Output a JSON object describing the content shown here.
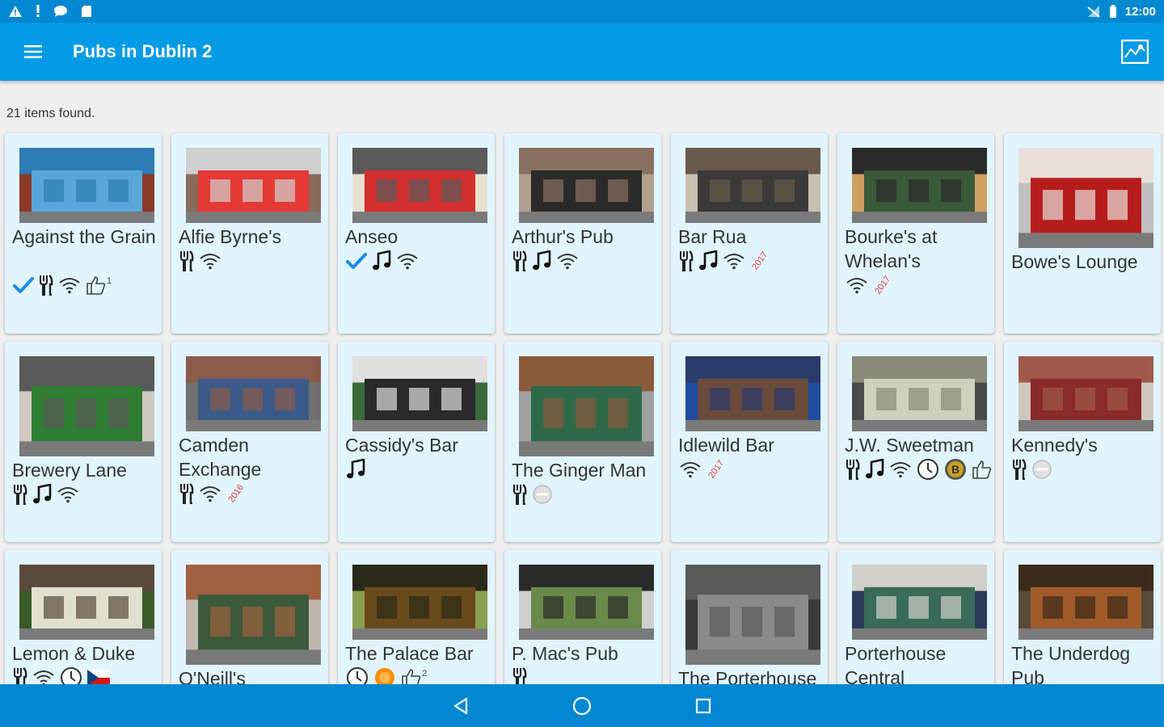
{
  "status_bar": {
    "time": "12:00"
  },
  "app_bar": {
    "title": "Pubs in  Dublin 2"
  },
  "results": {
    "count_text": "21 items found."
  },
  "colors": {
    "primary": "#039BE5",
    "primary_dark": "#0288D1",
    "card_bg": "#E1F5FE",
    "check": "#1E88E5",
    "year": "#E53935"
  },
  "pubs": [
    {
      "name": "Against the Grain",
      "icons": [
        "check-icon",
        "cutlery-icon",
        "wifi-icon",
        "thumbs-up-icon"
      ],
      "thumb_count": "1",
      "photo_colors": [
        "#2E7BB5",
        "#5BA6D8",
        "#8B3A2A"
      ]
    },
    {
      "name": "Alfie Byrne's",
      "icons": [
        "cutlery-icon",
        "wifi-icon"
      ],
      "photo_colors": [
        "#D0D0D0",
        "#E53935",
        "#8A6A5A"
      ]
    },
    {
      "name": "Anseo",
      "icons": [
        "check-icon",
        "music-note-icon",
        "wifi-icon"
      ],
      "photo_colors": [
        "#5A5A5A",
        "#D32F2F",
        "#E8E0D0"
      ]
    },
    {
      "name": "Arthur's Pub",
      "icons": [
        "cutlery-icon",
        "music-note-icon",
        "wifi-icon"
      ],
      "photo_colors": [
        "#8A7060",
        "#2A2A2A",
        "#B0A090"
      ]
    },
    {
      "name": "Bar Rua",
      "icons": [
        "cutlery-icon",
        "music-note-icon",
        "wifi-icon"
      ],
      "year": "2017",
      "photo_colors": [
        "#6A5A4A",
        "#3A3A3A",
        "#C8C0B0"
      ]
    },
    {
      "name": "Bourke's at Whelan's",
      "icons": [
        "wifi-icon"
      ],
      "year": "2017",
      "photo_colors": [
        "#2A2A2A",
        "#3A5A3A",
        "#D0A060"
      ]
    },
    {
      "name": "Bowe's Lounge",
      "icons": [],
      "photo_colors": [
        "#E8E0D8",
        "#B71C1C",
        "#C0C0C0"
      ]
    },
    {
      "name": "Brewery Lane",
      "icons": [
        "cutlery-icon",
        "music-note-icon",
        "wifi-icon"
      ],
      "photo_colors": [
        "#5A5A5A",
        "#2E7D32",
        "#D0C8C0"
      ]
    },
    {
      "name": "Camden Exchange",
      "icons": [
        "cutlery-icon",
        "wifi-icon"
      ],
      "year": "2016",
      "photo_colors": [
        "#8A5A4A",
        "#3A5A8A",
        "#707070"
      ]
    },
    {
      "name": "Cassidy's Bar",
      "icons": [
        "music-note-icon"
      ],
      "photo_colors": [
        "#E0E0E0",
        "#2A2A2A",
        "#3A6A3A"
      ]
    },
    {
      "name": "The Ginger Man",
      "icons": [
        "cutlery-icon",
        "no-entry-icon"
      ],
      "photo_colors": [
        "#8A5A3A",
        "#2E6A4A",
        "#A0A0A0"
      ]
    },
    {
      "name": "Idlewild Bar",
      "icons": [
        "wifi-icon"
      ],
      "year": "2017",
      "photo_colors": [
        "#2A3A6A",
        "#6A4A3A",
        "#1E4AA0"
      ]
    },
    {
      "name": "J.W. Sweetman",
      "icons": [
        "cutlery-icon",
        "music-note-icon",
        "wifi-icon",
        "clock-icon",
        "b-badge-icon",
        "thumbs-up-icon"
      ],
      "photo_colors": [
        "#8A8A7A",
        "#D0D0C0",
        "#4A4A4A"
      ]
    },
    {
      "name": "Kennedy's",
      "icons": [
        "cutlery-icon",
        "no-entry-icon"
      ],
      "photo_colors": [
        "#A05A4A",
        "#8A2A2A",
        "#D0C8C0"
      ]
    },
    {
      "name": "Lemon & Duke",
      "icons": [
        "cutlery-icon",
        "wifi-icon",
        "clock-icon",
        "czech-flag-icon"
      ],
      "photo_colors": [
        "#5A4A3A",
        "#E0E0D0",
        "#3A5A2A"
      ]
    },
    {
      "name": "O'Neill's",
      "icons": [],
      "photo_colors": [
        "#A06040",
        "#3A5A3A",
        "#C0B8B0"
      ]
    },
    {
      "name": "The Palace Bar",
      "icons": [
        "clock-icon",
        "sun-badge-icon",
        "thumbs-up-icon"
      ],
      "thumb_count": "2",
      "photo_colors": [
        "#2A2A1A",
        "#6A4A1A",
        "#8AA050"
      ]
    },
    {
      "name": "P. Mac's Pub",
      "icons": [
        "cutlery-icon"
      ],
      "photo_colors": [
        "#2A2A2A",
        "#6A8A4A",
        "#D0D0D0"
      ]
    },
    {
      "name": "The Porterhouse",
      "icons": [],
      "photo_colors": [
        "#5A5A5A",
        "#8A8A8A",
        "#3A3A3A"
      ]
    },
    {
      "name": "Porterhouse Central",
      "icons": [],
      "photo_colors": [
        "#D0D0C8",
        "#3A6A5A",
        "#2A3A5A"
      ]
    },
    {
      "name": "The Underdog Pub",
      "icons": [],
      "photo_colors": [
        "#3A2A1A",
        "#A05A2A",
        "#5A4A3A"
      ]
    }
  ],
  "nav": {
    "back": "back-icon",
    "home": "home-icon",
    "recents": "recents-icon"
  }
}
